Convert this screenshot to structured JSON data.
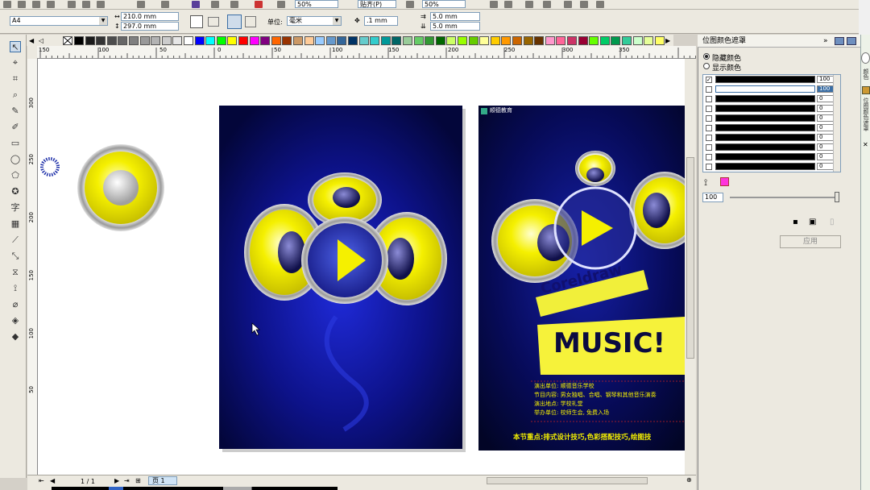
{
  "toolbar1": {
    "zoom_left": "50%",
    "snap": "贴齐(P)",
    "zoom_right": "50%"
  },
  "toolbar2": {
    "paper_size": "A4",
    "width": "210.0 mm",
    "height": "297.0 mm",
    "units_label": "单位:",
    "units_value": "毫米",
    "nudge": ".1 mm",
    "dup_x": "5.0 mm",
    "dup_y": "5.0 mm"
  },
  "palette": [
    "#000000",
    "#1a1a1a",
    "#333333",
    "#4d4d4d",
    "#666666",
    "#808080",
    "#999999",
    "#b3b3b3",
    "#cccccc",
    "#e6e6e6",
    "#ffffff",
    "#0000ff",
    "#00ffff",
    "#00ff00",
    "#ffff00",
    "#ff0000",
    "#ff00ff",
    "#800080",
    "#ff6600",
    "#993300",
    "#cc9966",
    "#ffcc99",
    "#99ccff",
    "#6699cc",
    "#336699",
    "#003366",
    "#66cccc",
    "#33cccc",
    "#009999",
    "#006666",
    "#99cc99",
    "#66cc66",
    "#339933",
    "#006600",
    "#ccff66",
    "#99ff00",
    "#66cc00",
    "#ffff99",
    "#ffcc00",
    "#ff9900",
    "#cc6600",
    "#996600",
    "#663300",
    "#ff99cc",
    "#ff6699",
    "#cc3366",
    "#990033",
    "#66ff00",
    "#00cc66",
    "#00994d",
    "#33cc99",
    "#ccffcc",
    "#e6ff99",
    "#ffff66"
  ],
  "rulers": {
    "h_labels": [
      "150",
      "100",
      "50",
      "0",
      "50",
      "100",
      "150",
      "200",
      "250",
      "300",
      "350"
    ],
    "v_labels": [
      "300",
      "250",
      "200",
      "150",
      "100",
      "50"
    ]
  },
  "docker": {
    "title": "位图颜色遮罩",
    "hide_colors": "隐藏颜色",
    "show_colors": "显示颜色",
    "rows": [
      {
        "checked": "✓",
        "tol": "100"
      },
      {
        "checked": "",
        "tol": "100"
      },
      {
        "checked": "",
        "tol": "0"
      },
      {
        "checked": "",
        "tol": "0"
      },
      {
        "checked": "",
        "tol": "0"
      },
      {
        "checked": "",
        "tol": "0"
      },
      {
        "checked": "",
        "tol": "0"
      },
      {
        "checked": "",
        "tol": "0"
      },
      {
        "checked": "",
        "tol": "0"
      },
      {
        "checked": "",
        "tol": "0"
      }
    ],
    "slider_value": "100",
    "apply_label": "应用"
  },
  "side_tabs": [
    "颜色",
    "位图颜色遮罩"
  ],
  "poster": {
    "logo_text": "顺德教育",
    "coreldraw": "Coreldraw",
    "music": "MUSIC!",
    "info_lines": [
      "演出单位: 顺德音乐学校",
      "节目内容: 男女独唱、合唱、钢琴和其他音乐演奏",
      "演出地点: 学校礼堂",
      "举办单位: 校师生会, 免费入场"
    ],
    "footer": "本节重点:排式设计技巧,色彩搭配技巧,绘图技"
  },
  "status": {
    "page_count": "1 / 1",
    "page_tab": "页 1"
  }
}
